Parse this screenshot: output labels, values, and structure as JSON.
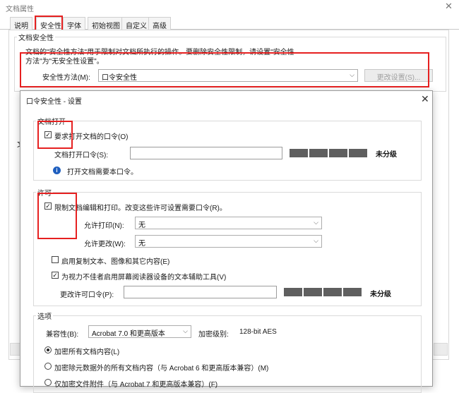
{
  "window": {
    "title": "文档属性",
    "close_glyph": "✕"
  },
  "tabs": [
    {
      "label": "说明"
    },
    {
      "label": "安全性"
    },
    {
      "label": "字体"
    },
    {
      "label": "初始视图"
    },
    {
      "label": "自定义"
    },
    {
      "label": "高级"
    }
  ],
  "security": {
    "group_title": "文档安全性",
    "description_line1": "文档的\"安全性方法\"用于限制对文档所执行的操作。要删除安全性限制，请设置\"安全性",
    "description_line2": "方法\"为\"无安全性设置\"。",
    "method_label": "安全性方法(M):",
    "method_value": "口令安全性",
    "change_settings_button": "更改设置(S)...",
    "hidden_group_char": "文"
  },
  "dialog": {
    "title": "口令安全性 - 设置",
    "close_glyph": "✕",
    "open": {
      "section_title": "文档打开",
      "require_password_label": "要求打开文档的口令(O)",
      "require_password_checked": true,
      "password_label": "文档打开口令(S):",
      "password_value": "",
      "strength": "未分级",
      "info_text": "打开文档需要本口令。"
    },
    "permissions": {
      "section_title": "许可",
      "restrict_label": "限制文档编辑和打印。改变这些许可设置需要口令(R)。",
      "restrict_checked": true,
      "printing_label": "允许打印(N):",
      "printing_value": "无",
      "changes_label": "允许更改(W):",
      "changes_value": "无",
      "enable_copy_label": "启用复制文本、图像和其它内容(E)",
      "enable_copy_checked": false,
      "screen_reader_label": "为视力不佳者启用屏幕阅读器设备的文本辅助工具(V)",
      "screen_reader_checked": true,
      "perm_password_label": "更改许可口令(P):",
      "perm_password_value": "",
      "strength": "未分级"
    },
    "options": {
      "section_title": "选项",
      "compat_label": "兼容性(B):",
      "compat_value": "Acrobat 7.0 和更高版本",
      "encryption_level_label": "加密级别:",
      "encryption_level_value": "128-bit AES",
      "radio_all": "加密所有文档内容(L)",
      "radio_except_metadata": "加密除元数据外的所有文档内容（与 Acrobat 6 和更高版本兼容）(M)",
      "radio_attachments": "仅加密文件附件（与 Acrobat 7 和更高版本兼容）(F)",
      "selected": "all"
    }
  },
  "colors": {
    "highlight": "#e62020",
    "meter": "#5f5f5f",
    "info": "#1f5fbf"
  }
}
